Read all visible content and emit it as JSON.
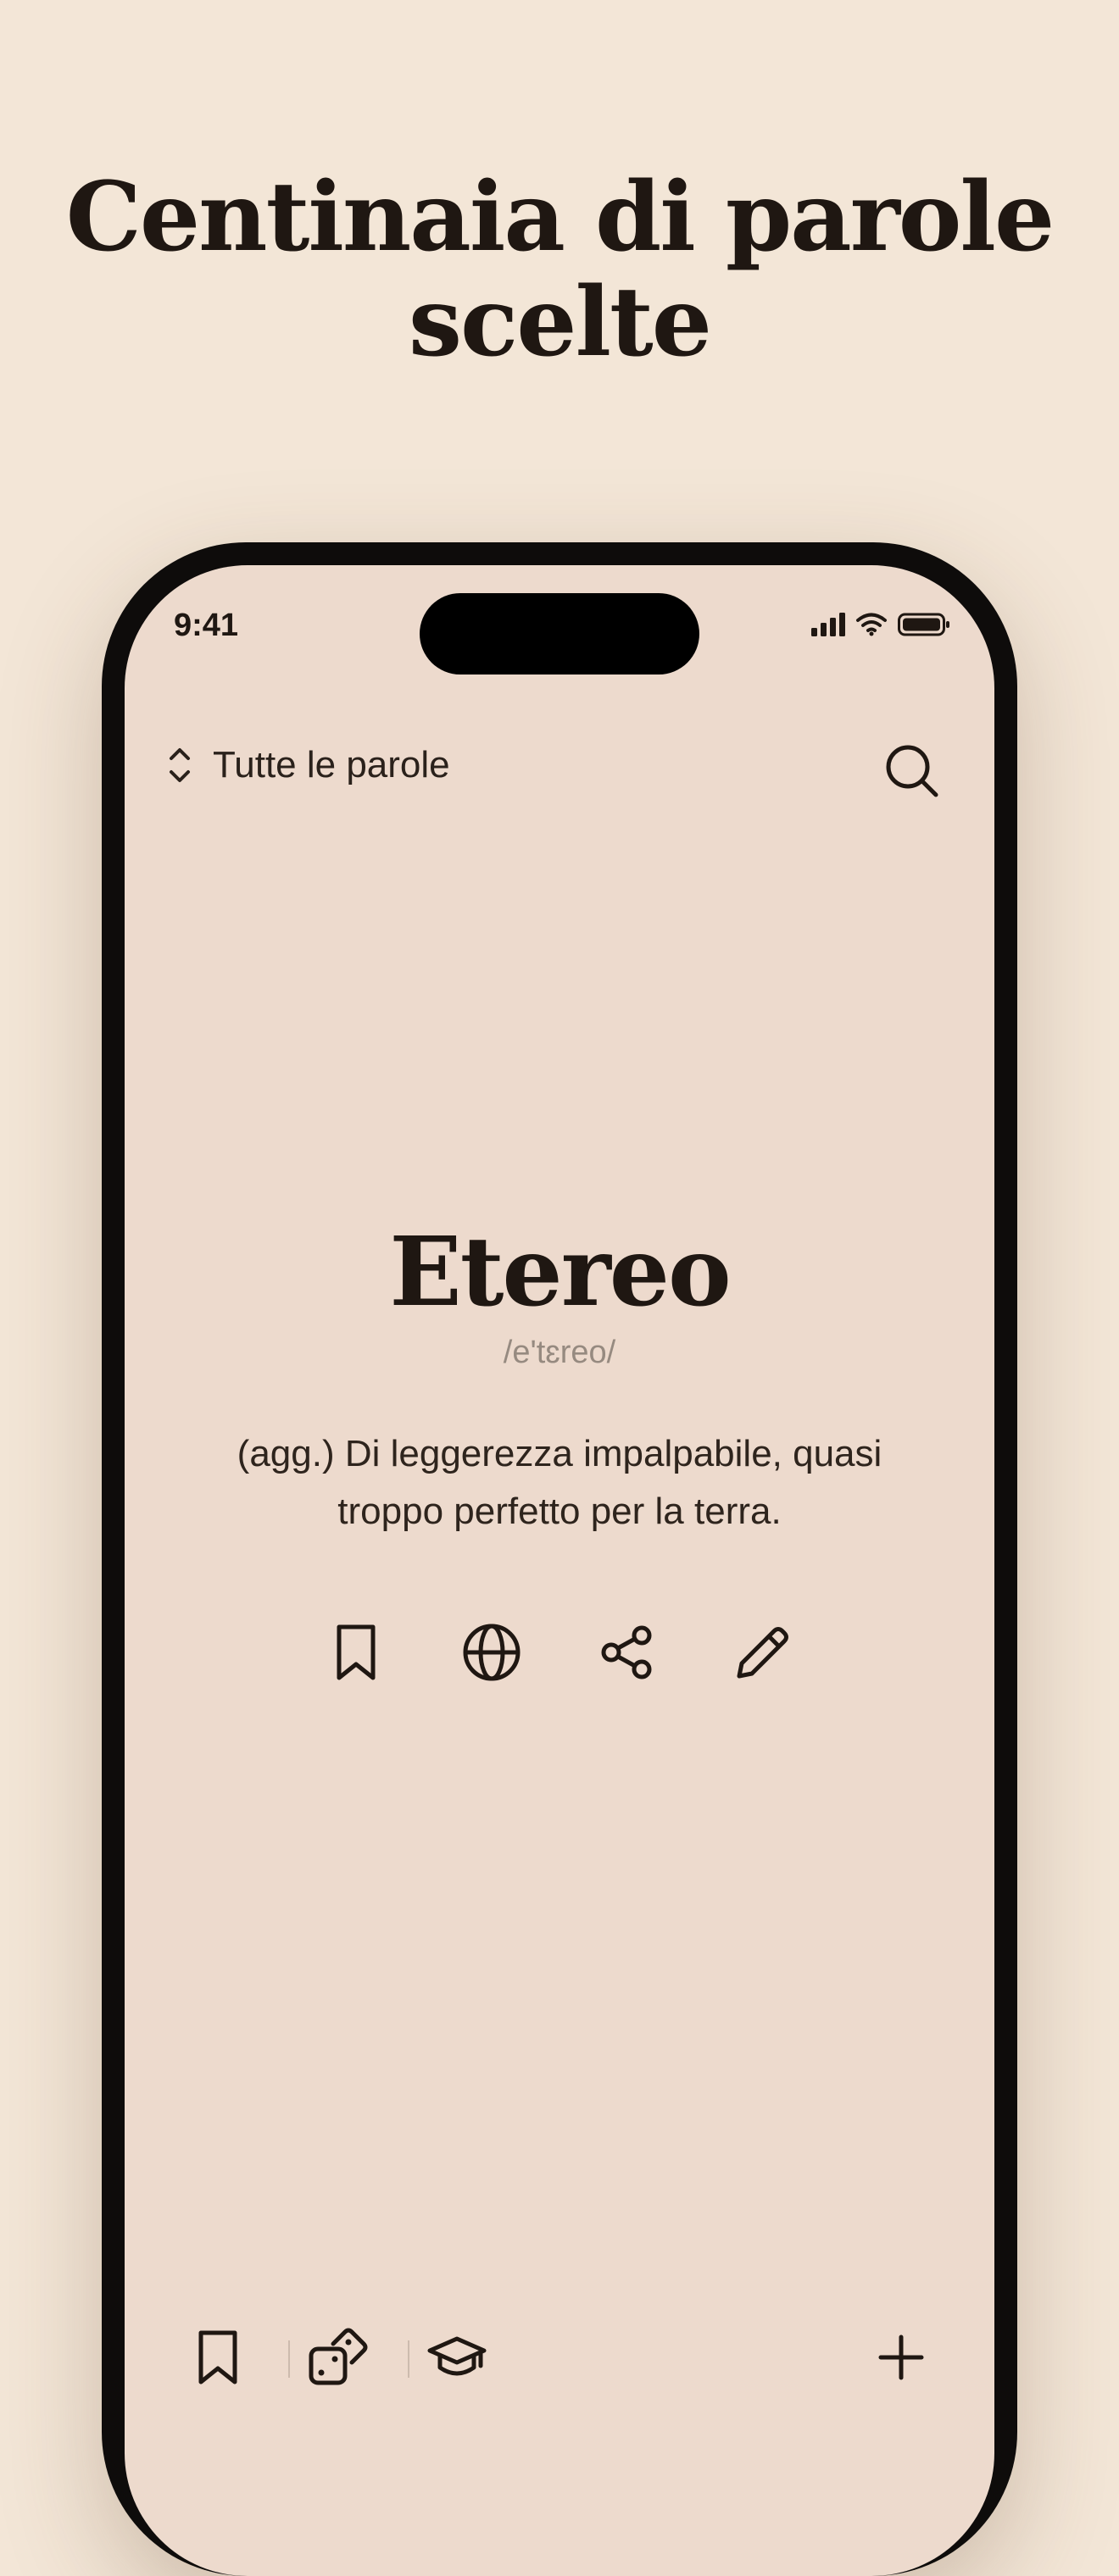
{
  "headline": {
    "line1": "Centinaia di parole",
    "line2": "scelte"
  },
  "status_bar": {
    "time": "9:41",
    "icons": [
      "signal-icon",
      "wifi-icon",
      "battery-icon"
    ]
  },
  "top_bar": {
    "filter_label": "Tutte le parole",
    "icons": [
      "chevron-up-down-icon",
      "search-icon",
      "profile-icon"
    ]
  },
  "word_card": {
    "word": "Etereo",
    "pronunciation": "/e'tɛreo/",
    "definition": "(agg.) Di leggerezza impalpabile, quasi troppo perfetto per la terra.",
    "action_icons": [
      "bookmark-icon",
      "globe-icon",
      "share-icon",
      "pencil-icon"
    ]
  },
  "bottom_bar": {
    "icons": [
      "bookmark-icon",
      "dice-icon",
      "graduation-cap-icon",
      "plus-icon"
    ]
  },
  "colors": {
    "page_background": "#f3e6d7",
    "screen_background": "#eddacd",
    "text_primary": "#1f1712",
    "text_muted": "#968a80",
    "phone_frame": "#0e0c0b"
  }
}
